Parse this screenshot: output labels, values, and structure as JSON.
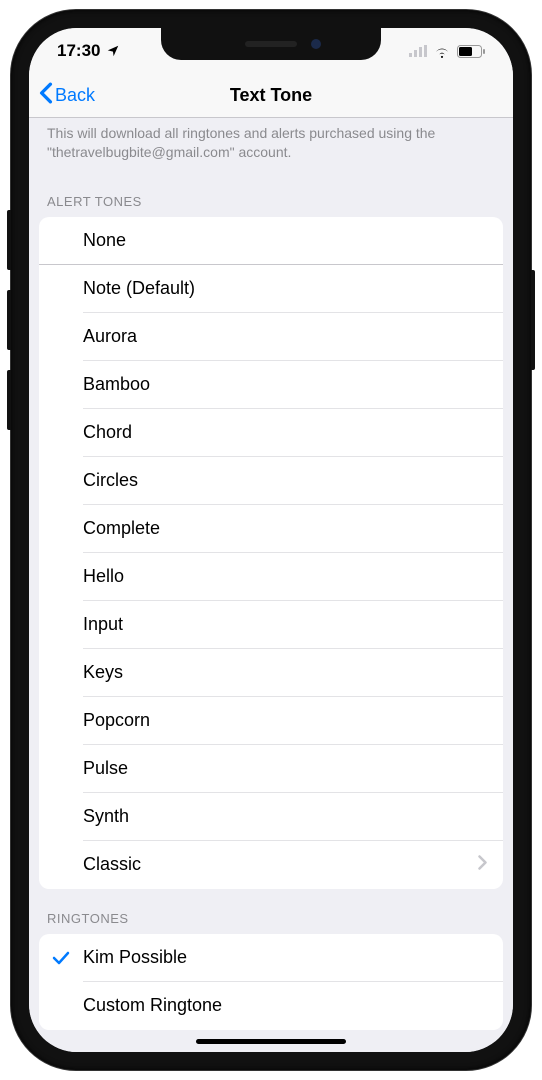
{
  "status": {
    "time": "17:30"
  },
  "nav": {
    "back": "Back",
    "title": "Text Tone"
  },
  "info": "This will download all ringtones and alerts purchased using the \"thetravelbugbite@gmail.com\" account.",
  "sections": {
    "alert_header": "ALERT TONES",
    "ringtone_header": "RINGTONES"
  },
  "alert_tones": [
    {
      "label": "None",
      "selected": false,
      "disclosure": false
    },
    {
      "label": "Note (Default)",
      "selected": false,
      "disclosure": false
    },
    {
      "label": "Aurora",
      "selected": false,
      "disclosure": false
    },
    {
      "label": "Bamboo",
      "selected": false,
      "disclosure": false
    },
    {
      "label": "Chord",
      "selected": false,
      "disclosure": false
    },
    {
      "label": "Circles",
      "selected": false,
      "disclosure": false
    },
    {
      "label": "Complete",
      "selected": false,
      "disclosure": false
    },
    {
      "label": "Hello",
      "selected": false,
      "disclosure": false
    },
    {
      "label": "Input",
      "selected": false,
      "disclosure": false
    },
    {
      "label": "Keys",
      "selected": false,
      "disclosure": false
    },
    {
      "label": "Popcorn",
      "selected": false,
      "disclosure": false
    },
    {
      "label": "Pulse",
      "selected": false,
      "disclosure": false
    },
    {
      "label": "Synth",
      "selected": false,
      "disclosure": false
    },
    {
      "label": "Classic",
      "selected": false,
      "disclosure": true
    }
  ],
  "ringtones": [
    {
      "label": "Kim Possible",
      "selected": true,
      "disclosure": false
    },
    {
      "label": "Custom Ringtone",
      "selected": false,
      "disclosure": false
    }
  ]
}
